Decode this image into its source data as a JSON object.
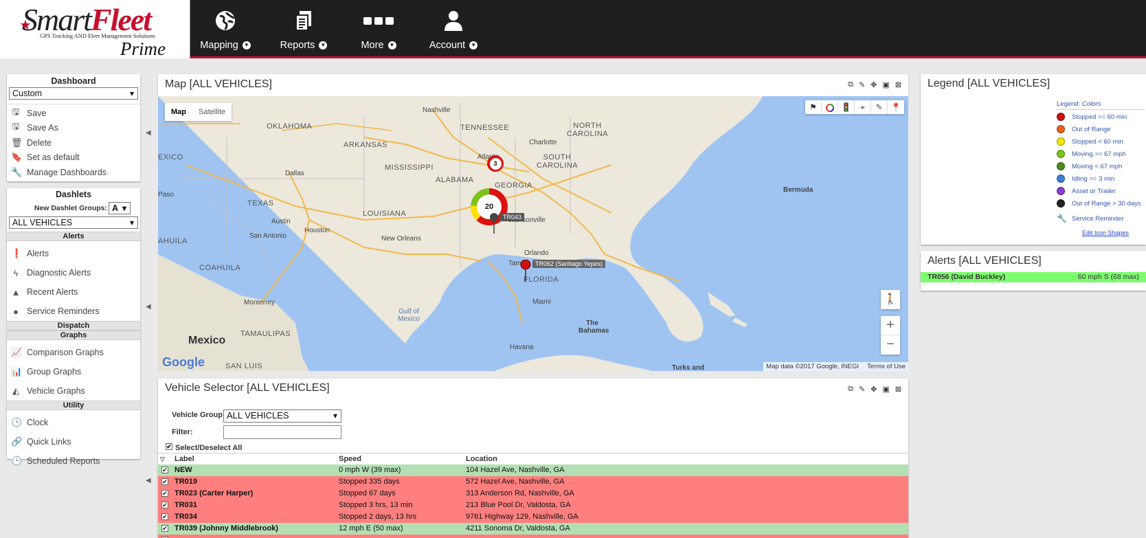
{
  "brand": {
    "name_part1": "Smart",
    "name_part2": "Fleet",
    "tagline": "GPS Tracking AND Fleet Management Solutions",
    "edition": "Prime"
  },
  "nav": [
    {
      "label": "Mapping"
    },
    {
      "label": "Reports"
    },
    {
      "label": "More"
    },
    {
      "label": "Account"
    }
  ],
  "dashboard": {
    "title": "Dashboard",
    "selected": "Custom",
    "actions": [
      "Save",
      "Save As",
      "Delete",
      "Set as default",
      "Manage Dashboards"
    ]
  },
  "dashlets": {
    "title": "Dashlets",
    "groups_label": "New Dashlet Groups:",
    "groups_value": "A",
    "vehicle_filter": "ALL VEHICLES",
    "alerts_header": "Alerts",
    "alerts_items": [
      "Alerts",
      "Diagnostic Alerts",
      "Recent Alerts",
      "Service Reminders"
    ],
    "dispatch_header": "Dispatch",
    "graphs_header": "Graphs",
    "graphs_items": [
      "Comparison Graphs",
      "Group Graphs",
      "Vehicle Graphs"
    ],
    "utility_header": "Utility",
    "utility_items": [
      "Clock",
      "Quick Links",
      "Scheduled Reports"
    ]
  },
  "map_panel": {
    "title": "Map  [ALL VEHICLES]",
    "type_map": "Map",
    "type_satellite": "Satellite",
    "cluster_large": "20",
    "cluster_small": "3",
    "marker_tr043": "TR043",
    "marker_tr062": "TR062 (Santiago Yepes)",
    "attribution": "Map data ©2017 Google, INEGI",
    "terms": "Terms of Use",
    "google": "Google",
    "labels": {
      "nashville": "Nashville",
      "oklahoma": "OKLAHOMA",
      "arkansas": "ARKANSAS",
      "tennessee": "TENNESSEE",
      "north_carolina": "NORTH CAROLINA",
      "charlotte": "Charlotte",
      "south_carolina": "SOUTH CAROLINA",
      "atlanta": "Atlanta",
      "mississippi": "MISSISSIPPI",
      "alabama": "ALABAMA",
      "georgia": "GEORGIA",
      "dallas": "Dallas",
      "texas": "TEXAS",
      "louisiana": "LOUISIANA",
      "austin": "Austin",
      "houston": "Houston",
      "san_antonio": "San Antonio",
      "new_orleans": "New Orleans",
      "jacksonville": "Jacksonville",
      "orlando": "Orlando",
      "tampa": "Tampa",
      "florida": "FLORIDA",
      "miami": "Miami",
      "bermuda": "Bermuda",
      "gulf": "Gulf of Mexico",
      "mexico": "Mexico",
      "the_bahamas": "The Bahamas",
      "havana": "Havana",
      "turks": "Turks and",
      "coahuila": "COAHUILA",
      "monterrey": "Monterrey",
      "tamaulipas": "TAMAULIPAS",
      "san_luis": "SAN LUIS",
      "paso": "Paso",
      "exico": "EXICO",
      "ahuila": "AHUILA"
    }
  },
  "vehicle_selector": {
    "title": "Vehicle Selector  [ALL VEHICLES]",
    "group_label": "Vehicle Group:",
    "group_value": "ALL VEHICLES",
    "filter_label": "Filter:",
    "filter_value": "",
    "select_all": "Select/Deselect All",
    "columns": [
      "Label",
      "Speed",
      "Location"
    ],
    "rows": [
      {
        "label": "NEW",
        "speed": "0 mph W (39 max)",
        "location": "104 Hazel Ave, Nashville, GA",
        "color": "#b3e0b3"
      },
      {
        "label": "TR019",
        "speed": "Stopped 335 days",
        "location": "572 Hazel Ave, Nashville, GA",
        "color": "#ff7f7f"
      },
      {
        "label": "TR023 (Carter Harper)",
        "speed": "Stopped 67 days",
        "location": "313 Anderson Rd, Nashville, GA",
        "color": "#ff7f7f"
      },
      {
        "label": "TR031",
        "speed": "Stopped 3 hrs, 13 min",
        "location": "213 Blue Pool Dr, Valdosta, GA",
        "color": "#ff7f7f"
      },
      {
        "label": "TR034",
        "speed": "Stopped 2 days, 13 hrs",
        "location": "9761 Highway 129, Nashville, GA",
        "color": "#ff7f7f"
      },
      {
        "label": "TR039 (Johnny Middlebrook)",
        "speed": "12 mph E (50 max)",
        "location": "4211 Sonoma Dr, Valdosta, GA",
        "color": "#b3e0b3"
      }
    ]
  },
  "legend": {
    "title": "Legend  [ALL VEHICLES]",
    "heading_prefix": "Legend:",
    "heading_colors": "Colors",
    "items": [
      {
        "label": "Stopped >= 60 min",
        "color": "#cc1111"
      },
      {
        "label": "Out of Range",
        "color": "#e8601c"
      },
      {
        "label": "Stopped < 60 min",
        "color": "#f5e600"
      },
      {
        "label": "Moving >= 67 mph",
        "color": "#7dc11a"
      },
      {
        "label": "Moving < 67 mph",
        "color": "#4e8a1e"
      },
      {
        "label": "Idling >= 3 min",
        "color": "#3b7dd8"
      },
      {
        "label": "Asset or Trailer",
        "color": "#8a3fd1"
      },
      {
        "label": "Out of Range > 30 days",
        "color": "#222222"
      }
    ],
    "service_reminder": "Service Reminder",
    "edit_link": "Edit Icon Shapes"
  },
  "alerts_panel": {
    "title": "Alerts  [ALL VEHICLES]",
    "row_vehicle": "TR056 (David Buckley)",
    "row_value": "60 mph S (68 max)"
  }
}
